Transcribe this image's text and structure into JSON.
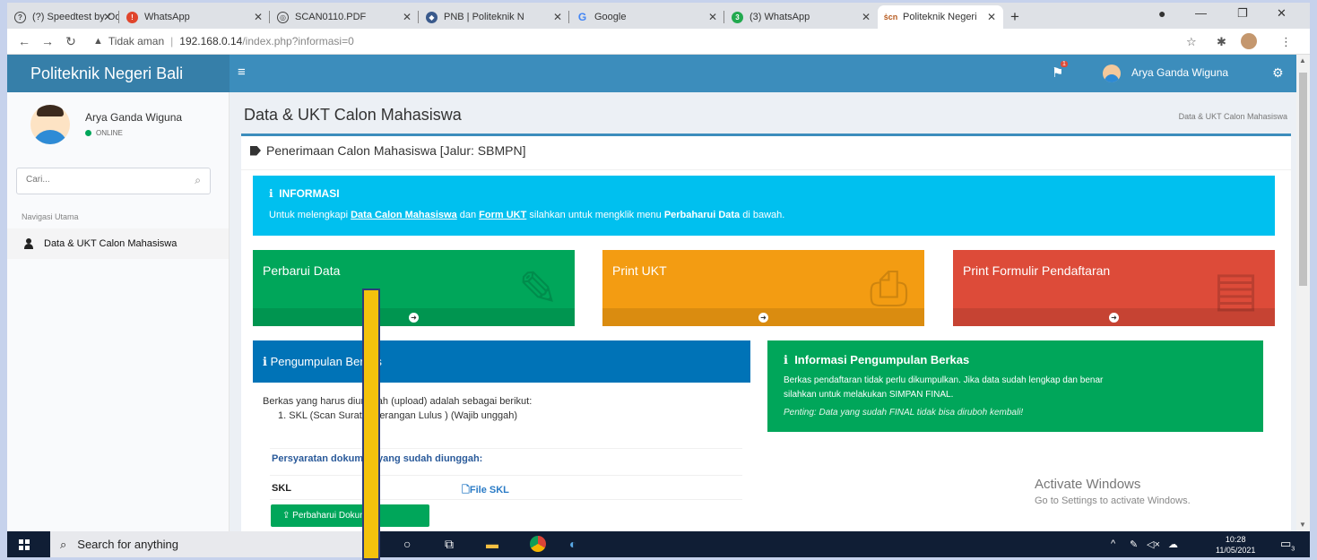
{
  "browser": {
    "tabs": [
      {
        "title": "(?) Speedtest by Ookla",
        "display": "(?) Speedtest by Oo",
        "favicon_color": "#444444"
      },
      {
        "title": "WhatsApp",
        "display": "WhatsApp",
        "favicon_color": "#e0452c"
      },
      {
        "title": "SCAN0110.PDF",
        "display": "SCAN0110.PDF",
        "favicon_color": "#444444"
      },
      {
        "title": "PNB | Politeknik Negeri Bali",
        "display": "PNB | Politeknik N",
        "favicon_color": "#444444"
      },
      {
        "title": "Google",
        "display": "Google",
        "favicon_color": "#4285f4"
      },
      {
        "title": "(3) WhatsApp",
        "display": "(3) WhatsApp",
        "favicon_color": "#22a94f"
      },
      {
        "title": "Politeknik Negeri Bali",
        "display": "Politeknik Negeri",
        "favicon_color": "#b65a1e"
      }
    ],
    "new_tab": "+",
    "security_label": "Tidak aman",
    "url_host": "192.168.0.14",
    "url_path": "/index.php?informasi=0"
  },
  "header": {
    "brand": "Politeknik Negeri Bali",
    "user_name": "Arya Ganda Wiguna",
    "notif_badge": "1"
  },
  "sidebar": {
    "user_name": "Arya Ganda Wiguna",
    "status": "ONLINE",
    "search_placeholder": "Cari...",
    "nav_header": "Navigasi Utama",
    "items": [
      {
        "label": "Data & UKT Calon Mahasiswa"
      }
    ]
  },
  "page": {
    "title": "Data & UKT Calon Mahasiswa",
    "breadcrumb": "Data & UKT Calon Mahasiswa",
    "box_title": "Penerimaan Calon Mahasiswa [Jalur: SBMPN]",
    "info": {
      "heading": "INFORMASI",
      "text_pre": "Untuk melengkapi ",
      "link1": "Data Calon Mahasiswa",
      "text_mid": " dan ",
      "link2": "Form UKT",
      "text_post1": " silahkan untuk mengklik menu ",
      "bold": "Perbaharui Data",
      "text_post2": " di bawah."
    },
    "tiles": [
      {
        "label": "Perbarui Data",
        "color": "#00a65a",
        "icon": "edit-icon"
      },
      {
        "label": "Print UKT",
        "color": "#f39c12",
        "icon": "printer-icon"
      },
      {
        "label": "Print Formulir Pendaftaran",
        "color": "#dd4b39",
        "icon": "document-icon"
      }
    ],
    "pengumpulan": {
      "title": "Pengumpulan Berkas",
      "intro": "Berkas yang harus diunggah (upload) adalah sebagai berikut:",
      "item1": "1. SKL (Scan Surat Keterangan Lulus ) (Wajib unggah)",
      "req_heading": "Persyaratan dokumen yang sudah diunggah:",
      "doc_name": "SKL",
      "file_link": "File SKL",
      "button": "Perbaharui Dokumen"
    },
    "info_pengumpulan": {
      "title": "Informasi Pengumpulan Berkas",
      "text1": "Berkas pendaftaran tidak perlu dikumpulkan. Jika data sudah lengkap dan benar",
      "text2": "silahkan untuk melakukan SIMPAN FINAL.",
      "note": "Penting: Data yang sudah FINAL tidak bisa diruboh kembali!"
    }
  },
  "watermark": {
    "line1": "Activate Windows",
    "line2": "Go to Settings to activate Windows."
  },
  "taskbar": {
    "search_placeholder": "Search for anything",
    "time": "10:28",
    "date": "11/05/2021",
    "notif_count": "3"
  },
  "colors": {
    "primary": "#3c8dbc",
    "info": "#00c0ef",
    "success": "#00a65a",
    "warning": "#f39c12",
    "danger": "#dd4b39",
    "highlight_bar": "#f4c20d"
  }
}
